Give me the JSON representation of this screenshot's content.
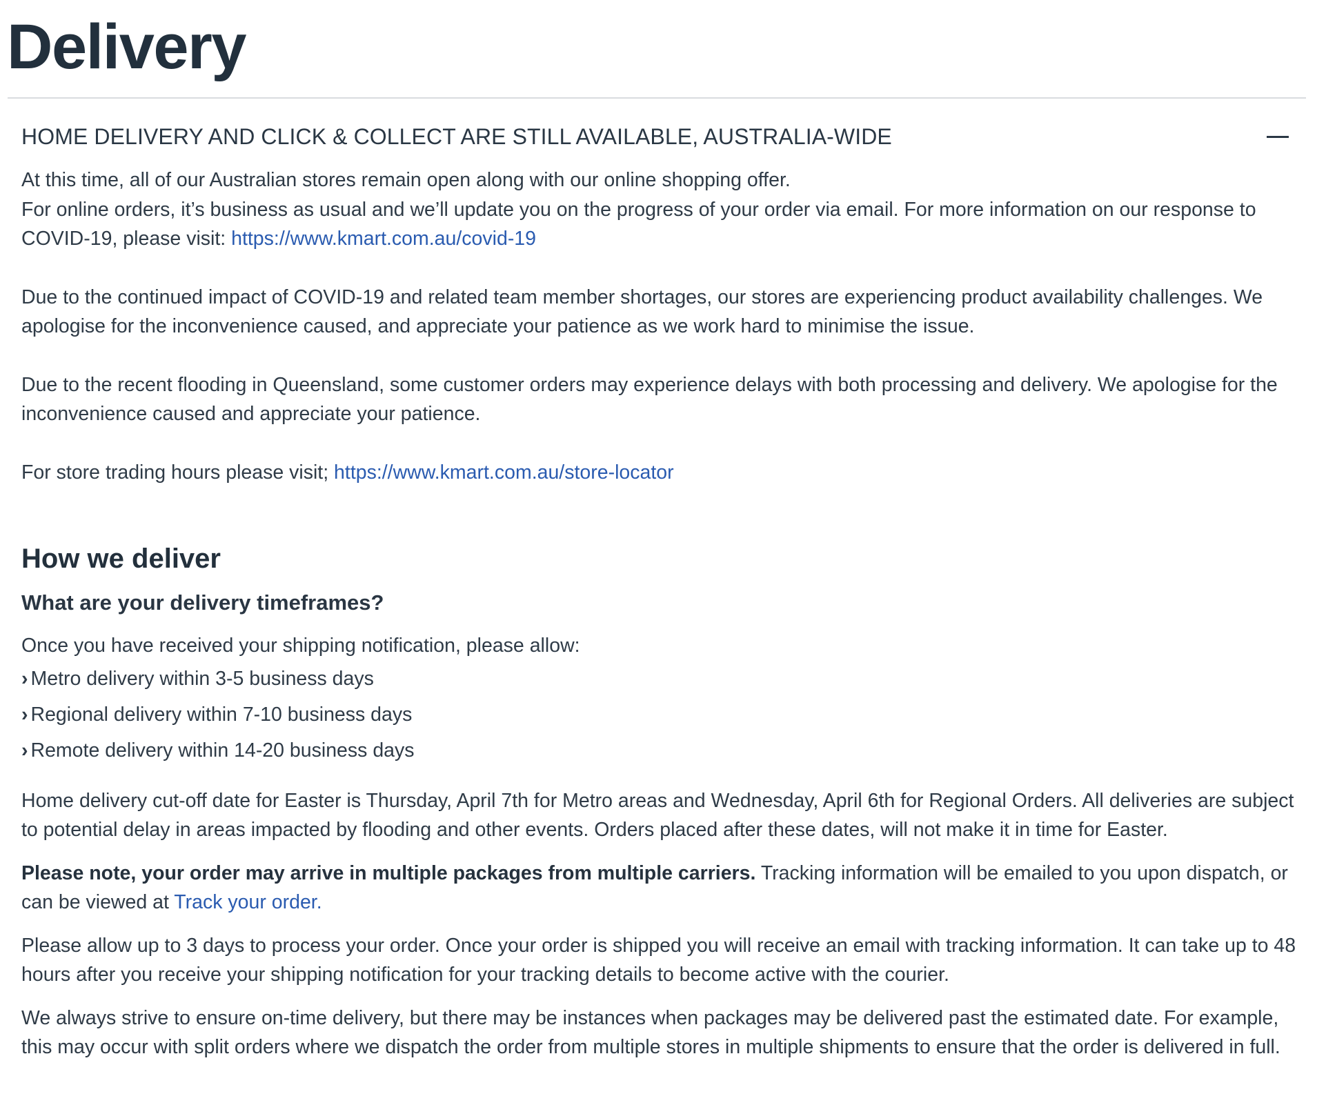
{
  "page": {
    "title": "Delivery"
  },
  "accordion": {
    "title": "HOME DELIVERY AND CLICK & COLLECT ARE STILL AVAILABLE, AUSTRALIA-WIDE",
    "collapse_icon": "minus-icon",
    "p1_line1": "At this time, all of our Australian stores remain open along with our online shopping offer.",
    "p1_line2": "For online orders, it’s business as usual and we’ll update you on the progress of your order via email. For more information on our response to COVID-19, please visit: ",
    "covid_link": "https://www.kmart.com.au/covid-19",
    "p2": "Due to the continued impact of COVID-19 and related team member shortages, our stores are experiencing product availability challenges. We apologise for the inconvenience caused, and appreciate your patience as we work hard to minimise the issue.",
    "p3": "Due to the recent flooding in Queensland, some customer orders may experience delays with both processing and delivery. We apologise for the inconvenience caused and appreciate your patience.",
    "p4_text": "For store trading hours please visit; ",
    "store_link": "https://www.kmart.com.au/store-locator"
  },
  "how_we_deliver": {
    "heading": "How we deliver",
    "subheading": "What are your delivery timeframes?",
    "intro": "Once you have received your shipping notification, please allow:",
    "items": [
      "Metro delivery within 3-5 business days",
      "Regional delivery within 7-10 business days",
      "Remote delivery within 14-20 business days"
    ],
    "chevron": "›",
    "easter": "Home delivery cut-off date for Easter is Thursday, April 7th for Metro areas and Wednesday, April 6th for Regional Orders. All deliveries are subject to potential delay in areas impacted by flooding and other events. Orders placed after these dates, will not make it in time for Easter.",
    "note_bold": "Please note, your order may arrive in multiple packages from multiple carriers.",
    "note_text": " Tracking information will be emailed to you upon dispatch, or can be viewed at ",
    "track_link": "Track your order.",
    "processing": "Please allow up to 3 days to process your order. Once your order is shipped you will receive an email with tracking information. It can take up to 48 hours after you receive your shipping notification for your tracking details to become active with the courier.",
    "ontime": "We always strive to ensure on-time delivery, but there may be instances when packages may be delivered past the estimated date. For example, this may occur with split orders where we dispatch the order from multiple stores in multiple shipments to ensure that the order is delivered in full."
  },
  "colors": {
    "text": "#2f3b47",
    "heading": "#22303d",
    "link": "#2a5bb0",
    "divider": "#d9dcdf"
  }
}
